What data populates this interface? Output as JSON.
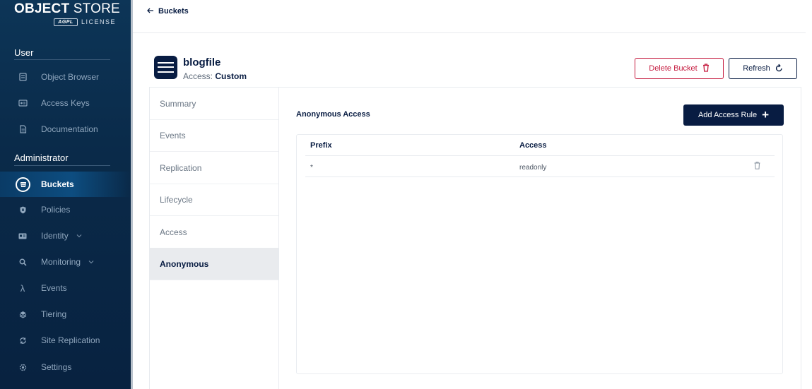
{
  "sidebar": {
    "logo": {
      "brand_bold": "OBJECT",
      "brand_light": " STORE",
      "agpl": "AGPL",
      "license": "LICENSE"
    },
    "user_section": "User",
    "user_items": [
      {
        "label": "Object Browser",
        "icon": "bucket-browser-icon"
      },
      {
        "label": "Access Keys",
        "icon": "key-icon"
      },
      {
        "label": "Documentation",
        "icon": "document-icon"
      }
    ],
    "admin_section": "Administrator",
    "admin_items": [
      {
        "label": "Buckets",
        "icon": "bucket-icon",
        "active": true
      },
      {
        "label": "Policies",
        "icon": "shield-icon"
      },
      {
        "label": "Identity",
        "icon": "id-card-icon",
        "expandable": true
      },
      {
        "label": "Monitoring",
        "icon": "magnifier-icon",
        "expandable": true
      },
      {
        "label": "Events",
        "icon": "lambda-icon"
      },
      {
        "label": "Tiering",
        "icon": "layers-icon"
      },
      {
        "label": "Site Replication",
        "icon": "sync-icon"
      },
      {
        "label": "Settings",
        "icon": "gear-icon"
      }
    ]
  },
  "topbar": {
    "back_label": "Buckets"
  },
  "bucket": {
    "name": "blogfile",
    "access_label": "Access: ",
    "access_value": "Custom"
  },
  "actions": {
    "delete_label": "Delete Bucket",
    "refresh_label": "Refresh",
    "add_rule_label": "Add Access Rule"
  },
  "tabs": [
    {
      "label": "Summary"
    },
    {
      "label": "Events"
    },
    {
      "label": "Replication"
    },
    {
      "label": "Lifecycle"
    },
    {
      "label": "Access"
    },
    {
      "label": "Anonymous",
      "active": true
    }
  ],
  "content": {
    "title": "Anonymous Access",
    "columns": [
      "Prefix",
      "Access"
    ],
    "rows": [
      {
        "prefix": "*",
        "access": "readonly"
      }
    ]
  },
  "colors": {
    "sidebar": "#0a2a49",
    "primary": "#081c42",
    "danger": "#c51b3f"
  }
}
